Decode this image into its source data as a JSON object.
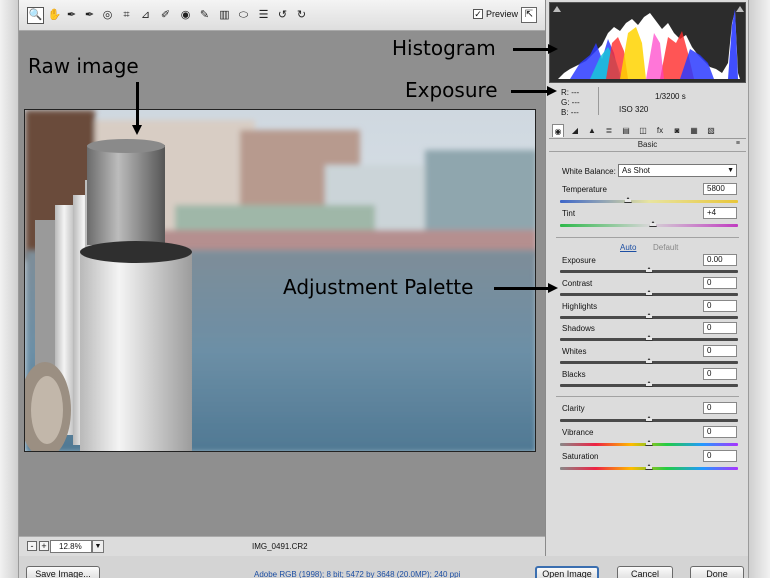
{
  "toolbar": {
    "tools": [
      {
        "name": "zoom-tool",
        "icon": "magnifier-icon",
        "glyph": "🔍"
      },
      {
        "name": "hand-tool",
        "icon": "hand-icon",
        "glyph": "✋"
      },
      {
        "name": "white-balance-tool",
        "icon": "eyedropper-icon",
        "glyph": "✒"
      },
      {
        "name": "color-sampler-tool",
        "icon": "sampler-icon",
        "glyph": "✒"
      },
      {
        "name": "targeted-adjustment-tool",
        "icon": "target-icon",
        "glyph": "◎"
      },
      {
        "name": "crop-tool",
        "icon": "crop-icon",
        "glyph": "⌗"
      },
      {
        "name": "straighten-tool",
        "icon": "straighten-icon",
        "glyph": "⊿"
      },
      {
        "name": "spot-removal-tool",
        "icon": "brush-heal-icon",
        "glyph": "✐"
      },
      {
        "name": "red-eye-tool",
        "icon": "eye-icon",
        "glyph": "◉"
      },
      {
        "name": "adjustment-brush-tool",
        "icon": "brush-icon",
        "glyph": "✎"
      },
      {
        "name": "graduated-filter-tool",
        "icon": "gradient-icon",
        "glyph": "▥"
      },
      {
        "name": "radial-filter-tool",
        "icon": "ellipse-icon",
        "glyph": "⬭"
      },
      {
        "name": "preferences-tool",
        "icon": "list-icon",
        "glyph": "☰"
      },
      {
        "name": "rotate-left-tool",
        "icon": "rotate-ccw-icon",
        "glyph": "↺"
      },
      {
        "name": "rotate-right-tool",
        "icon": "rotate-cw-icon",
        "glyph": "↻"
      }
    ],
    "preview_label": "Preview",
    "preview_checked_glyph": "✓",
    "fullscreen_glyph": "⇱"
  },
  "status": {
    "zoom_minus": "-",
    "zoom_plus": "+",
    "zoom_value": "12.8%",
    "zoom_drop": "▼",
    "filename": "IMG_0491.CR2"
  },
  "bottom": {
    "save_label": "Save Image...",
    "workflow": "Adobe RGB (1998); 8 bit; 5472 by 3648 (20.0MP); 240 ppi",
    "open_label": "Open Image",
    "cancel_label": "Cancel",
    "done_label": "Done"
  },
  "info": {
    "r": "R:  ---",
    "g": "G:  ---",
    "b": "B:  ---",
    "shutter": "1/3200 s",
    "iso": "ISO 320"
  },
  "panel": {
    "tabs": [
      {
        "name": "tab-basic",
        "icon": "aperture-icon",
        "glyph": "◉"
      },
      {
        "name": "tab-tone-curve",
        "icon": "curve-icon",
        "glyph": "◢"
      },
      {
        "name": "tab-detail",
        "icon": "detail-icon",
        "glyph": "▲"
      },
      {
        "name": "tab-hsl",
        "icon": "bars-icon",
        "glyph": "≣"
      },
      {
        "name": "tab-split-toning",
        "icon": "split-icon",
        "glyph": "▤"
      },
      {
        "name": "tab-lens",
        "icon": "lens-icon",
        "glyph": "◫"
      },
      {
        "name": "tab-effects",
        "icon": "fx-icon",
        "glyph": "fx"
      },
      {
        "name": "tab-camera-calibration",
        "icon": "camera-icon",
        "glyph": "◙"
      },
      {
        "name": "tab-presets",
        "icon": "presets-icon",
        "glyph": "▦"
      },
      {
        "name": "tab-snapshots",
        "icon": "snapshots-icon",
        "glyph": "▧"
      }
    ],
    "section_title": "Basic",
    "white_balance_label": "White Balance:",
    "white_balance_value": "As Shot",
    "auto_label": "Auto",
    "default_label": "Default",
    "sliders": [
      {
        "name": "temperature",
        "label": "Temperature",
        "value": "5800",
        "level": 0.38
      },
      {
        "name": "tint",
        "label": "Tint",
        "value": "+4",
        "level": 0.52
      },
      {
        "name": "exposure",
        "label": "Exposure",
        "value": "0.00",
        "level": 0.5
      },
      {
        "name": "contrast",
        "label": "Contrast",
        "value": "0",
        "level": 0.5
      },
      {
        "name": "highlights",
        "label": "Highlights",
        "value": "0",
        "level": 0.5
      },
      {
        "name": "shadows",
        "label": "Shadows",
        "value": "0",
        "level": 0.5
      },
      {
        "name": "whites",
        "label": "Whites",
        "value": "0",
        "level": 0.5
      },
      {
        "name": "blacks",
        "label": "Blacks",
        "value": "0",
        "level": 0.5
      },
      {
        "name": "clarity",
        "label": "Clarity",
        "value": "0",
        "level": 0.5
      },
      {
        "name": "vibrance",
        "label": "Vibrance",
        "value": "0",
        "level": 0.5
      },
      {
        "name": "saturation",
        "label": "Saturation",
        "value": "0",
        "level": 0.5
      }
    ]
  },
  "annotations": {
    "histogram": "Histogram",
    "exposure": "Exposure",
    "raw_image": "Raw image",
    "adjustment_palette": "Adjustment Palette"
  },
  "colors": {
    "link": "#1d4fa3",
    "default_button_border": "#3b6fb0",
    "canvas": "#8f8f8f"
  }
}
